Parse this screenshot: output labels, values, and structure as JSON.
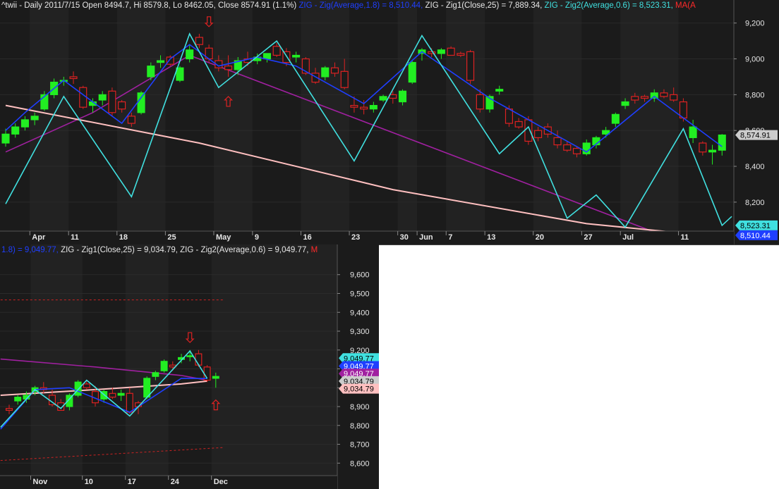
{
  "colors": {
    "background": "#1b1b1b",
    "grid": "#2a2a2a",
    "up_candle": "#22ee22",
    "down_candle": "#dd2222",
    "zig_average": "#1f3fff",
    "zig1": "#a020a0",
    "zig2": "#40e0e0",
    "ma": "#ffc0c0",
    "arrow": "#dd2222",
    "text": "#e6e6e6"
  },
  "top_header": [
    {
      "text": "^twii - Daily 2011/7/15 Open 8494.7, Hi 8579.8, Lo 8462.05, Close 8574.91 (1.1%) ",
      "color": "#e6e6e6"
    },
    {
      "text": "ZIG - Zig(Average,1.8) = 8,510.44, ",
      "color": "#1f3fff"
    },
    {
      "text": "ZIG - Zig1(Close,25) = 7,889.34, ",
      "color": "#e6e6e6"
    },
    {
      "text": "ZIG - Zig2(Average,0.6) = 8,523.31, ",
      "color": "#40e0e0"
    },
    {
      "text": "MA(A",
      "color": "#ff2a2a"
    }
  ],
  "bottom_header": [
    {
      "text": "1.8) = 9,049.77, ",
      "color": "#1f3fff"
    },
    {
      "text": "ZIG - Zig1(Close,25) = 9,034.79, ",
      "color": "#e6e6e6"
    },
    {
      "text": "ZIG - Zig2(Average,0.6) = 9,049.77, ",
      "color": "#e6e6e6"
    },
    {
      "text": "M",
      "color": "#ff2a2a"
    }
  ],
  "chart_data": [
    {
      "type": "candlestick",
      "title": "^twii - Daily 2011/7/15",
      "ylim": [
        8050,
        9250
      ],
      "y_ticks": [
        "9,200",
        "9,000",
        "8,800",
        "8,600",
        "8,400",
        "8,200"
      ],
      "y_tick_values": [
        9200,
        9000,
        8800,
        8600,
        8400,
        8200
      ],
      "x_ticks": [
        {
          "label": "Apr",
          "index": 3,
          "bold": true
        },
        {
          "label": "11",
          "index": 7
        },
        {
          "label": "18",
          "index": 12
        },
        {
          "label": "25",
          "index": 17
        },
        {
          "label": "May",
          "index": 22,
          "bold": true
        },
        {
          "label": "9",
          "index": 26
        },
        {
          "label": "16",
          "index": 31
        },
        {
          "label": "23",
          "index": 36
        },
        {
          "label": "30",
          "index": 41
        },
        {
          "label": "Jun",
          "index": 43,
          "bold": true
        },
        {
          "label": "7",
          "index": 46
        },
        {
          "label": "13",
          "index": 50
        },
        {
          "label": "20",
          "index": 55
        },
        {
          "label": "27",
          "index": 60
        },
        {
          "label": "Jul",
          "index": 64,
          "bold": true
        },
        {
          "label": "11",
          "index": 70
        }
      ],
      "bars": [
        [
          8530,
          8610,
          8510,
          8580
        ],
        [
          8580,
          8640,
          8560,
          8620
        ],
        [
          8620,
          8680,
          8600,
          8660
        ],
        [
          8660,
          8700,
          8630,
          8680
        ],
        [
          8720,
          8820,
          8710,
          8800
        ],
        [
          8800,
          8890,
          8780,
          8870
        ],
        [
          8880,
          8900,
          8850,
          8880
        ],
        [
          8900,
          8930,
          8860,
          8890
        ],
        [
          8840,
          8850,
          8720,
          8730
        ],
        [
          8740,
          8780,
          8700,
          8760
        ],
        [
          8770,
          8820,
          8740,
          8800
        ],
        [
          8820,
          8840,
          8680,
          8700
        ],
        [
          8760,
          8770,
          8700,
          8720
        ],
        [
          8680,
          8700,
          8620,
          8640
        ],
        [
          8700,
          8820,
          8690,
          8810
        ],
        [
          8900,
          8980,
          8880,
          8960
        ],
        [
          8980,
          9020,
          8950,
          8990
        ],
        [
          9010,
          9020,
          8960,
          8970
        ],
        [
          8880,
          8960,
          8870,
          8950
        ],
        [
          9000,
          9080,
          8980,
          9050
        ],
        [
          9120,
          9140,
          9060,
          9080
        ],
        [
          9060,
          9080,
          8980,
          9000
        ],
        [
          8990,
          9020,
          8930,
          8950
        ],
        [
          8960,
          9020,
          8900,
          8940
        ],
        [
          8940,
          9010,
          8910,
          8990
        ],
        [
          9000,
          9040,
          8960,
          8980
        ],
        [
          8990,
          9030,
          8970,
          9010
        ],
        [
          9000,
          9030,
          8980,
          9030
        ],
        [
          9070,
          9090,
          9010,
          9020
        ],
        [
          9040,
          9060,
          8960,
          8980
        ],
        [
          9010,
          9040,
          8980,
          9020
        ],
        [
          9000,
          9010,
          8910,
          8920
        ],
        [
          8920,
          8950,
          8860,
          8870
        ],
        [
          8900,
          8960,
          8880,
          8950
        ],
        [
          8950,
          8980,
          8900,
          8920
        ],
        [
          8930,
          9000,
          8830,
          8840
        ],
        [
          8740,
          8790,
          8700,
          8730
        ],
        [
          8730,
          8770,
          8690,
          8720
        ],
        [
          8720,
          8760,
          8700,
          8740
        ],
        [
          8770,
          8800,
          8760,
          8790
        ],
        [
          8800,
          8820,
          8750,
          8780
        ],
        [
          8760,
          8830,
          8740,
          8820
        ],
        [
          8870,
          8990,
          8860,
          8980
        ],
        [
          9030,
          9060,
          8990,
          9050
        ],
        [
          9040,
          9060,
          9010,
          9030
        ],
        [
          9030,
          9060,
          9000,
          9050
        ],
        [
          9060,
          9070,
          9020,
          9020
        ],
        [
          9030,
          9040,
          9010,
          9020
        ],
        [
          9040,
          9050,
          8860,
          8880
        ],
        [
          8800,
          8830,
          8700,
          8720
        ],
        [
          8720,
          8800,
          8700,
          8790
        ],
        [
          8820,
          8850,
          8800,
          8830
        ],
        [
          8720,
          8740,
          8620,
          8640
        ],
        [
          8650,
          8670,
          8610,
          8620
        ],
        [
          8660,
          8680,
          8520,
          8540
        ],
        [
          8600,
          8620,
          8540,
          8560
        ],
        [
          8620,
          8640,
          8560,
          8580
        ],
        [
          8560,
          8600,
          8500,
          8520
        ],
        [
          8520,
          8540,
          8480,
          8490
        ],
        [
          8500,
          8510,
          8450,
          8470
        ],
        [
          8470,
          8550,
          8460,
          8530
        ],
        [
          8520,
          8570,
          8500,
          8560
        ],
        [
          8580,
          8620,
          8560,
          8600
        ],
        [
          8640,
          8700,
          8620,
          8690
        ],
        [
          8740,
          8780,
          8720,
          8760
        ],
        [
          8790,
          8810,
          8750,
          8770
        ],
        [
          8790,
          8800,
          8760,
          8780
        ],
        [
          8780,
          8830,
          8760,
          8810
        ],
        [
          8810,
          8830,
          8780,
          8790
        ],
        [
          8800,
          8840,
          8760,
          8770
        ],
        [
          8760,
          8780,
          8650,
          8670
        ],
        [
          8560,
          8660,
          8530,
          8620
        ],
        [
          8530,
          8540,
          8460,
          8480
        ],
        [
          8480,
          8520,
          8410,
          8490
        ],
        [
          8490,
          8580,
          8460,
          8575
        ]
      ],
      "series": [
        {
          "name": "ZIG - Zig(Average,1.8)",
          "style": "zig_average",
          "points": [
            [
              0,
              8600
            ],
            [
              2,
              8700
            ],
            [
              6,
              8880
            ],
            [
              12,
              8640
            ],
            [
              17,
              9000
            ],
            [
              19,
              9080
            ],
            [
              22,
              8960
            ],
            [
              26,
              9010
            ],
            [
              30,
              8960
            ],
            [
              37,
              8750
            ],
            [
              43,
              9040
            ],
            [
              50,
              8780
            ],
            [
              60,
              8480
            ],
            [
              67,
              8790
            ],
            [
              74,
              8510
            ]
          ]
        },
        {
          "name": "ZIG - Zig1(Close,25)",
          "style": "zig1",
          "points": [
            [
              0,
              8480
            ],
            [
              9,
              8700
            ],
            [
              19,
              9020
            ],
            [
              74,
              7889
            ]
          ]
        },
        {
          "name": "ZIG - Zig2(Average,0.6)",
          "style": "zig2",
          "points": [
            [
              0,
              8190
            ],
            [
              6,
              8790
            ],
            [
              13,
              8230
            ],
            [
              19,
              9140
            ],
            [
              22,
              8840
            ],
            [
              28,
              9100
            ],
            [
              36,
              8430
            ],
            [
              43,
              9130
            ],
            [
              51,
              8470
            ],
            [
              54,
              8620
            ],
            [
              58,
              8110
            ],
            [
              61,
              8240
            ],
            [
              64,
              8060
            ],
            [
              70,
              8610
            ],
            [
              74,
              8070
            ],
            [
              75,
              8120
            ]
          ]
        },
        {
          "name": "MA",
          "style": "ma",
          "points": [
            [
              0,
              8740
            ],
            [
              20,
              8530
            ],
            [
              40,
              8270
            ],
            [
              60,
              8080
            ],
            [
              75,
              8000
            ]
          ]
        }
      ],
      "value_tags": [
        {
          "text": "8,574.91",
          "value": 8575,
          "bg": "#cccccc",
          "fg": "#000000"
        },
        {
          "text": "8,523.31",
          "value": 8070,
          "bg": "#40e0e0",
          "fg": "#000000"
        },
        {
          "text": "8,510.44",
          "value": 8015,
          "bg": "#1f3fff",
          "fg": "#ffffff"
        }
      ],
      "arrows": [
        {
          "index": 21,
          "value": 9180,
          "dir": "down"
        },
        {
          "index": 23,
          "value": 8790,
          "dir": "up"
        }
      ]
    },
    {
      "type": "candlestick",
      "ylim": [
        8545,
        9685
      ],
      "y_ticks": [
        "9,600",
        "9,500",
        "9,400",
        "9,300",
        "9,200",
        "9,100",
        "9,000",
        "8,900",
        "8,800",
        "8,700",
        "8,600"
      ],
      "y_tick_values": [
        9600,
        9500,
        9400,
        9300,
        9200,
        9100,
        9000,
        8900,
        8800,
        8700,
        8600
      ],
      "x_ticks": [
        {
          "label": "Nov",
          "index": 3,
          "bold": true
        },
        {
          "label": "10",
          "index": 9
        },
        {
          "label": "17",
          "index": 14
        },
        {
          "label": "24",
          "index": 19
        },
        {
          "label": "Dec",
          "index": 24,
          "bold": true
        }
      ],
      "bars": [
        [
          8890,
          8910,
          8860,
          8880
        ],
        [
          8930,
          8960,
          8910,
          8950
        ],
        [
          8940,
          8980,
          8920,
          8960
        ],
        [
          8980,
          9010,
          8960,
          9000
        ],
        [
          9000,
          9030,
          8970,
          8990
        ],
        [
          8960,
          8990,
          8900,
          8910
        ],
        [
          8920,
          8940,
          8880,
          8880
        ],
        [
          8900,
          8970,
          8880,
          8960
        ],
        [
          8960,
          9040,
          8950,
          9030
        ],
        [
          9020,
          9040,
          8990,
          9000
        ],
        [
          8980,
          9010,
          8900,
          8920
        ],
        [
          8940,
          8990,
          8920,
          8980
        ],
        [
          8970,
          9000,
          8940,
          8950
        ],
        [
          8960,
          8990,
          8930,
          8970
        ],
        [
          8970,
          9000,
          8860,
          8870
        ],
        [
          8920,
          8930,
          8860,
          8900
        ],
        [
          8950,
          9060,
          8940,
          9050
        ],
        [
          9060,
          9090,
          9040,
          9080
        ],
        [
          9090,
          9150,
          9080,
          9140
        ],
        [
          9120,
          9140,
          9090,
          9110
        ],
        [
          9150,
          9180,
          9130,
          9160
        ],
        [
          9170,
          9200,
          9140,
          9170
        ],
        [
          9180,
          9200,
          9110,
          9120
        ],
        [
          9110,
          9120,
          9030,
          9040
        ],
        [
          9050,
          9080,
          9000,
          9060
        ]
      ],
      "series": [
        {
          "name": "ZIG - Zig(Average,1.8)",
          "style": "zig_average",
          "points": [
            [
              -1,
              8780
            ],
            [
              3,
              8990
            ],
            [
              7,
              9000
            ],
            [
              14,
              8870
            ],
            [
              20,
              9050
            ],
            [
              23,
              9049
            ]
          ]
        },
        {
          "name": "ZIG - Zig1(Close,25)",
          "style": "zig1",
          "points": [
            [
              -1,
              9152
            ],
            [
              10,
              9110
            ],
            [
              20,
              9065
            ],
            [
              23,
              9040
            ]
          ]
        },
        {
          "name": "ZIG - Zig2(Average,0.6)",
          "style": "zig2",
          "points": [
            [
              -1,
              8790
            ],
            [
              3,
              8990
            ],
            [
              6,
              8890
            ],
            [
              9,
              9040
            ],
            [
              14,
              8850
            ],
            [
              21,
              9195
            ],
            [
              23,
              9049
            ]
          ]
        },
        {
          "name": "MA",
          "style": "ma",
          "points": [
            [
              -1,
              8960
            ],
            [
              10,
              8990
            ],
            [
              20,
              9020
            ],
            [
              23,
              9035
            ]
          ]
        }
      ],
      "dashed_lines": [
        {
          "from": [
            -1,
            9466
          ],
          "to": [
            25,
            9466
          ]
        },
        {
          "from": [
            -1,
            8614
          ],
          "to": [
            25,
            8683
          ]
        }
      ],
      "value_tags": [
        {
          "text": "9,049.77",
          "value": 9157,
          "bg": "#40e0e0",
          "fg": "#000000"
        },
        {
          "text": "9,049.77",
          "value": 9115,
          "bg": "#1f3fff",
          "fg": "#ffffff"
        },
        {
          "text": "9,049.77",
          "value": 9075,
          "bg": "#a020a0",
          "fg": "#ffffff"
        },
        {
          "text": "9,034.79",
          "value": 9035,
          "bg": "#cccccc",
          "fg": "#000000"
        },
        {
          "text": "9,034.79",
          "value": 8995,
          "bg": "#ffc0c0",
          "fg": "#000000"
        }
      ],
      "arrows": [
        {
          "index": 21,
          "value": 9240,
          "dir": "down"
        },
        {
          "index": 24,
          "value": 8935,
          "dir": "up"
        }
      ]
    }
  ]
}
